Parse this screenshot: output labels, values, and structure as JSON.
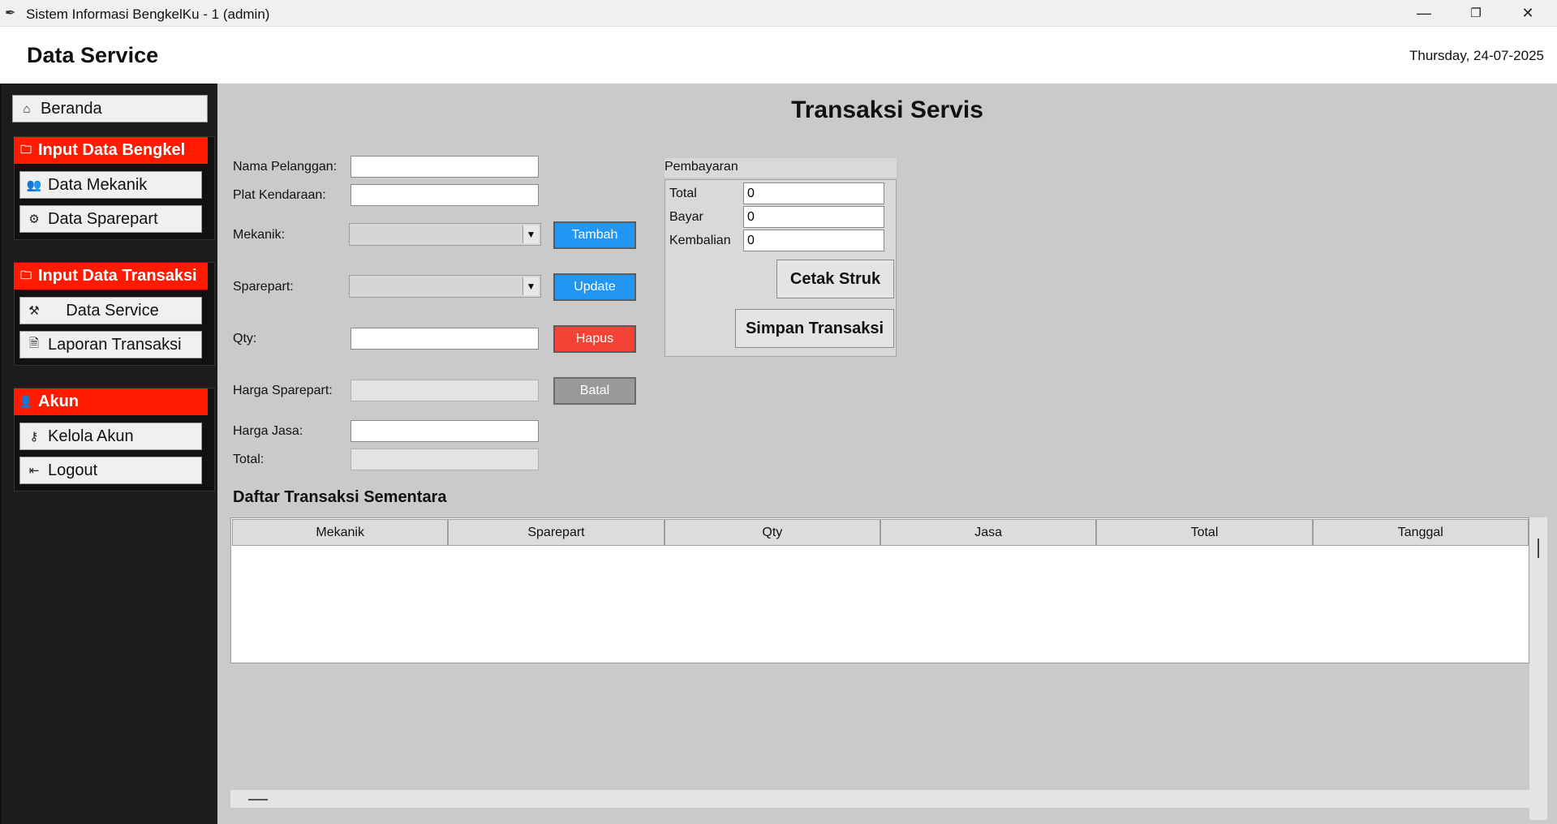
{
  "window": {
    "title": "Sistem Informasi BengkelKu - 1 (admin)",
    "minimize": "—",
    "restore": "❐",
    "close": "✕"
  },
  "header": {
    "title": "Data Service",
    "date": "Thursday, 24-07-2025"
  },
  "sidebar": {
    "home": {
      "label": "Beranda",
      "icon": "home-icon"
    },
    "groups": [
      {
        "title": "Input Data Bengkel",
        "icon": "folder-icon",
        "items": [
          {
            "label": "Data Mekanik",
            "icon": "users-icon"
          },
          {
            "label": "Data Sparepart",
            "icon": "gear-icon"
          }
        ]
      },
      {
        "title": "Input Data Transaksi",
        "icon": "folder-icon",
        "items": [
          {
            "label": "Data Service",
            "icon": "tools-icon"
          },
          {
            "label": "Laporan Transaksi",
            "icon": "document-icon"
          }
        ]
      },
      {
        "title": "Akun",
        "icon": "user-icon",
        "items": [
          {
            "label": "Kelola Akun",
            "icon": "key-icon"
          },
          {
            "label": "Logout",
            "icon": "logout-icon"
          }
        ]
      }
    ]
  },
  "form": {
    "heading": "Transaksi Servis",
    "nama_pelanggan": {
      "label": "Nama Pelanggan:",
      "value": ""
    },
    "plat_kendaraan": {
      "label": "Plat Kendaraan:",
      "value": ""
    },
    "mekanik": {
      "label": "Mekanik:",
      "value": ""
    },
    "sparepart": {
      "label": "Sparepart:",
      "value": ""
    },
    "qty": {
      "label": "Qty:",
      "value": ""
    },
    "harga_sparepart": {
      "label": "Harga Sparepart:",
      "value": ""
    },
    "harga_jasa": {
      "label": "Harga Jasa:",
      "value": ""
    },
    "total": {
      "label": "Total:",
      "value": ""
    }
  },
  "actions": {
    "tambah": "Tambah",
    "update": "Update",
    "hapus": "Hapus",
    "batal": "Batal"
  },
  "colors": {
    "accent_blue": "#2196f3",
    "danger_red": "#f44336",
    "gray_button": "#9a9a9a",
    "sidebar_header_red": "#ff1a00"
  },
  "payment": {
    "legend": "Pembayaran",
    "total_label": "Total",
    "total_value": "0",
    "bayar_label": "Bayar",
    "bayar_value": "0",
    "kembalian_label": "Kembalian",
    "kembalian_value": "0",
    "cetak_struk": "Cetak Struk",
    "simpan_transaksi": "Simpan Transaksi"
  },
  "table": {
    "title": "Daftar Transaksi Sementara",
    "columns": [
      "Mekanik",
      "Sparepart",
      "Qty",
      "Jasa",
      "Total",
      "Tanggal"
    ],
    "rows": []
  }
}
